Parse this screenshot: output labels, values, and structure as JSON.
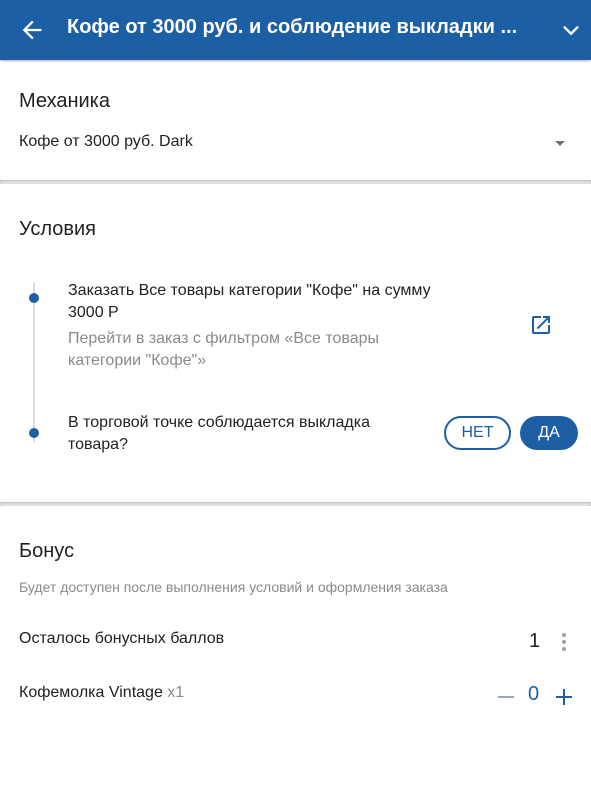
{
  "header": {
    "title": "Кофе от 3000 руб. и соблюдение выкладки ...",
    "back_icon": "arrow-back-icon",
    "expand_icon": "chevron-down-icon"
  },
  "mechanics": {
    "heading": "Механика",
    "selected_value": "Кофе от 3000 руб. Dark",
    "dropdown_icon": "dropdown-arrow-icon"
  },
  "conditions": {
    "heading": "Условия",
    "items": [
      {
        "line1": "Заказать Все товары категории \"Кофе\" на сумму",
        "line2": "3000 Р",
        "hint_line1": "Перейти в заказ с фильтром «Все товары",
        "hint_line2": "категории \"Кофе\"»",
        "action_icon": "open-in-new-icon"
      },
      {
        "line1": "В торговой точке соблюдается выкладка",
        "line2": "товара?",
        "no_label": "НЕТ",
        "yes_label": "ДА"
      }
    ]
  },
  "bonus": {
    "heading": "Бонус",
    "subtitle": "Будет доступен после выполнения условий и оформления заказа",
    "remaining_label": "Осталось бонусных баллов",
    "remaining_value": "1",
    "more_icon": "more-vert-icon",
    "product_name": "Кофемолка Vintage",
    "product_multiplier": "x1",
    "product_quantity": "0",
    "minus_icon": "minus-icon",
    "plus_icon": "plus-icon"
  },
  "colors": {
    "primary": "#1d5fa5",
    "muted_text": "#8a8a8a",
    "divider": "#e3e3e3"
  }
}
